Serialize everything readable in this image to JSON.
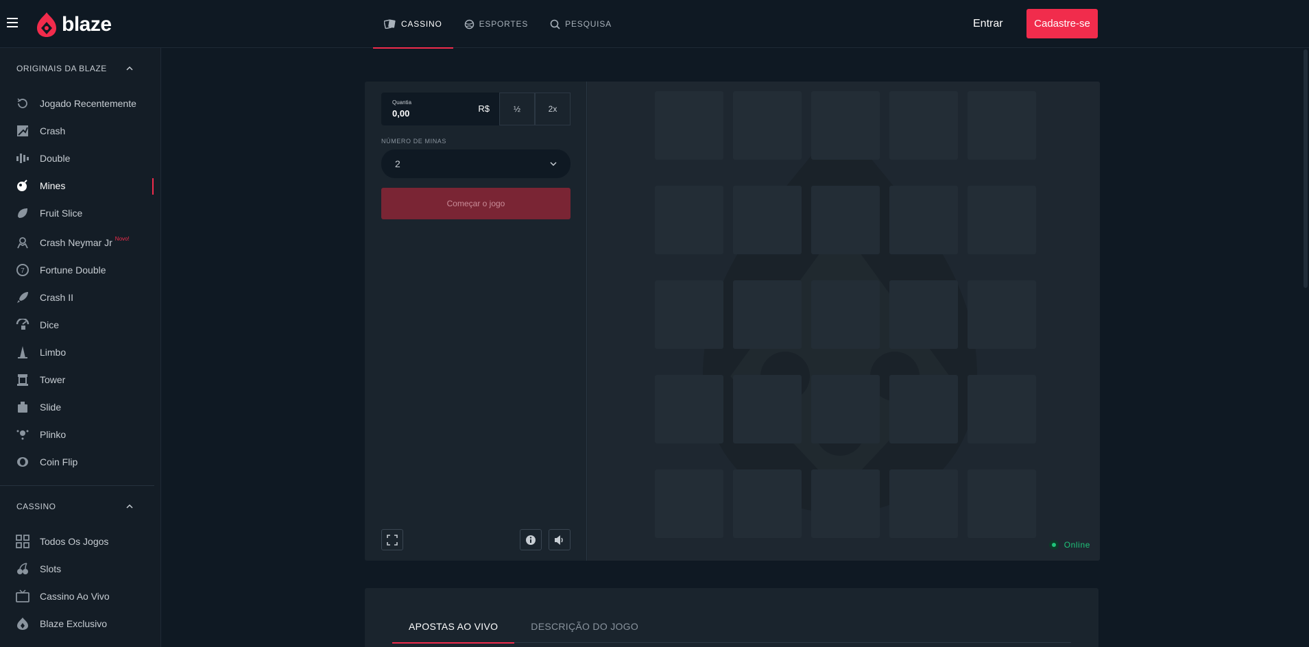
{
  "header": {
    "logo_text": "blaze",
    "nav": [
      {
        "label": "CASSINO",
        "icon": "cards-icon",
        "active": true
      },
      {
        "label": "ESPORTES",
        "icon": "ball-icon",
        "active": false
      },
      {
        "label": "PESQUISA",
        "icon": "search-icon",
        "active": false
      }
    ],
    "login_label": "Entrar",
    "signup_label": "Cadastre-se"
  },
  "sidebar": {
    "originals_title": "ORIGINAIS DA BLAZE",
    "originals": [
      {
        "label": "Jogado Recentemente",
        "icon": "history-icon"
      },
      {
        "label": "Crash",
        "icon": "crash-icon"
      },
      {
        "label": "Double",
        "icon": "double-icon"
      },
      {
        "label": "Mines",
        "icon": "bomb-icon",
        "active": true
      },
      {
        "label": "Fruit Slice",
        "icon": "fruit-icon"
      },
      {
        "label": "Crash Neymar Jr",
        "icon": "neymar-icon",
        "badge": "Novo!"
      },
      {
        "label": "Fortune Double",
        "icon": "fortune-icon"
      },
      {
        "label": "Crash II",
        "icon": "rocket-icon"
      },
      {
        "label": "Dice",
        "icon": "dice-icon"
      },
      {
        "label": "Limbo",
        "icon": "limbo-icon"
      },
      {
        "label": "Tower",
        "icon": "tower-icon"
      },
      {
        "label": "Slide",
        "icon": "slide-icon"
      },
      {
        "label": "Plinko",
        "icon": "plinko-icon"
      },
      {
        "label": "Coin Flip",
        "icon": "coin-icon"
      }
    ],
    "casino_title": "CASSINO",
    "casino": [
      {
        "label": "Todos Os Jogos",
        "icon": "grid-icon"
      },
      {
        "label": "Slots",
        "icon": "cherry-icon"
      },
      {
        "label": "Cassino Ao Vivo",
        "icon": "tv-icon"
      },
      {
        "label": "Blaze Exclusivo",
        "icon": "flame-icon"
      }
    ]
  },
  "game": {
    "amount_label": "Quantia",
    "amount_value": "0,00",
    "currency": "R$",
    "half_label": "½",
    "double_label": "2x",
    "mines_label": "NÚMERO DE MINAS",
    "mines_value": "2",
    "start_label": "Começar o jogo",
    "online_label": "Online",
    "colors": {
      "accent": "#f12c4c",
      "online": "#1fc47a"
    }
  },
  "bets": {
    "tabs": [
      {
        "label": "APOSTAS AO VIVO",
        "active": true
      },
      {
        "label": "DESCRIÇÃO DO JOGO",
        "active": false
      }
    ]
  }
}
